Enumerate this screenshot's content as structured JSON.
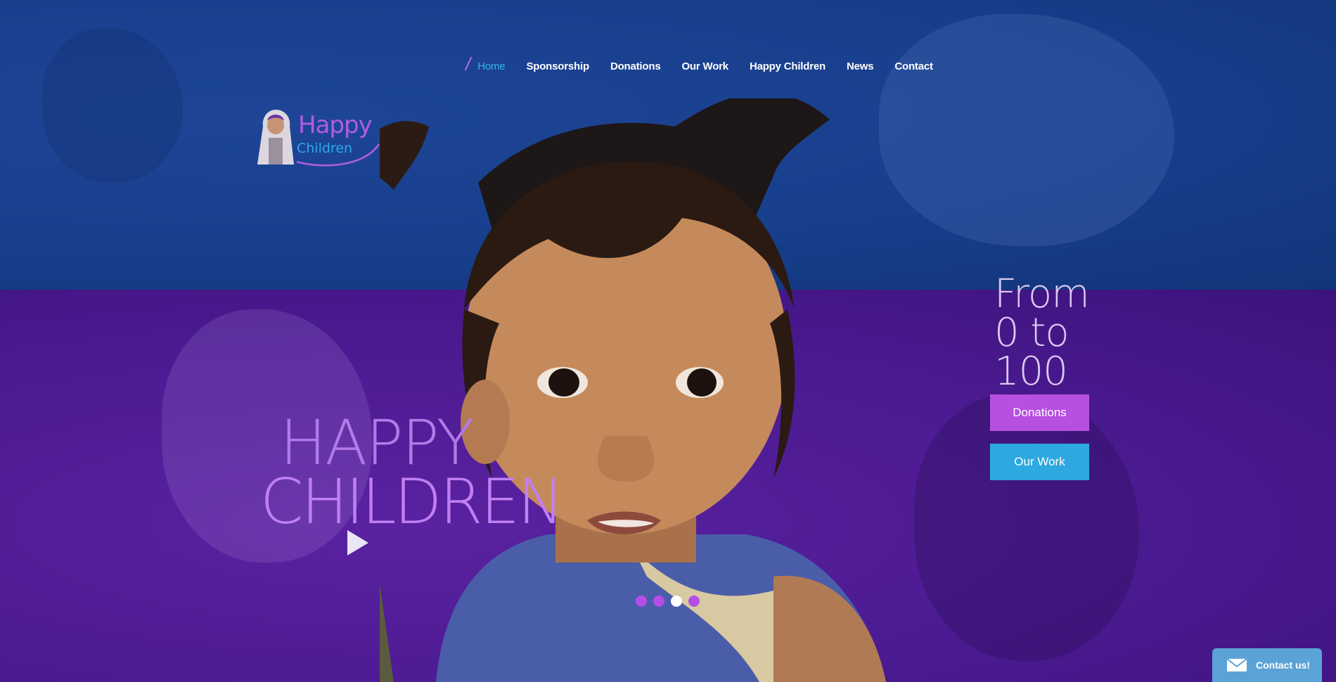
{
  "nav": {
    "items": [
      {
        "label": "Home",
        "active": true
      },
      {
        "label": "Sponsorship",
        "active": false
      },
      {
        "label": "Donations",
        "active": false
      },
      {
        "label": "Our Work",
        "active": false
      },
      {
        "label": "Happy Children",
        "active": false
      },
      {
        "label": "News",
        "active": false
      },
      {
        "label": "Contact",
        "active": false
      }
    ]
  },
  "logo": {
    "line1": "Happy",
    "line2": "Children"
  },
  "hero": {
    "headline_line1": "HAPPY",
    "headline_line2": "CHILDREN",
    "tagline": [
      "From",
      "0 to",
      "100"
    ],
    "buttons": {
      "donations": "Donations",
      "our_work": "Our Work"
    },
    "slider": {
      "total": 4,
      "active_index": 3
    }
  },
  "contact_widget": {
    "label": "Contact us!"
  },
  "colors": {
    "top_blue": "#183f8c",
    "bottom_purple": "#4b1a91",
    "accent_purple": "#b74fe0",
    "accent_blue": "#2ea8e0",
    "nav_active": "#35b7ef"
  }
}
